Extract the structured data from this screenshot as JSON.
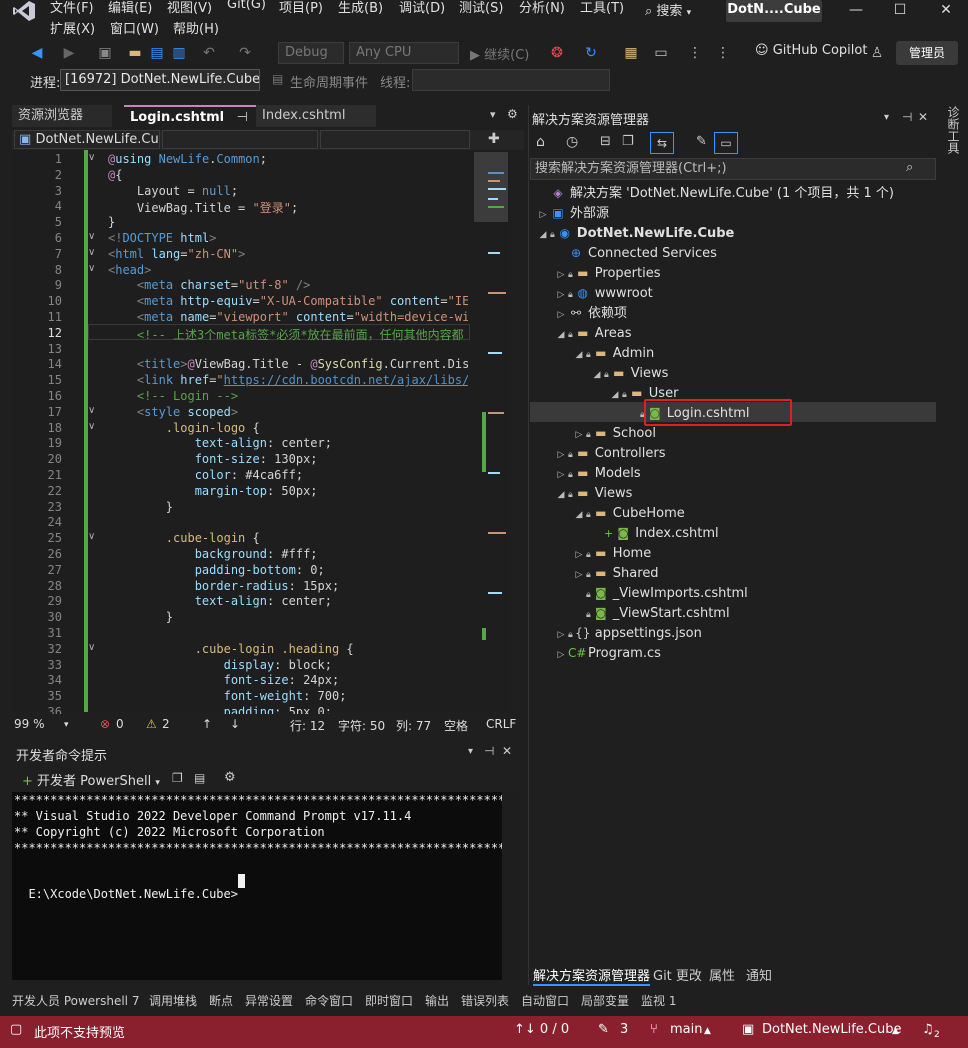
{
  "menu": {
    "items": [
      "文件(F)",
      "编辑(E)",
      "视图(V)",
      "Git(G)",
      "项目(P)",
      "生成(B)",
      "调试(D)",
      "测试(S)",
      "分析(N)",
      "工具(T)",
      "扩展(X)",
      "窗口(W)",
      "帮助(H)"
    ],
    "search": "搜索",
    "title_badge": "DotN....Cube"
  },
  "toolbar": {
    "config": "Debug",
    "platform": "Any CPU",
    "continue": "继续(C)",
    "copilot": "GitHub Copilot",
    "admin": "管理员"
  },
  "process_bar": {
    "process_label": "进程:",
    "process_value": "[16972] DotNet.NewLife.Cube.e",
    "lifecycle_label": "生命周期事件",
    "thread_label": "线程:"
  },
  "editor": {
    "tabs": [
      "资源浏览器",
      "Login.cshtml",
      "Index.cshtml"
    ],
    "nav_scope": "DotNet.NewLife.Cub",
    "zoom": "99 %",
    "errors": "0",
    "warnings": "2",
    "line": "行: 12",
    "char": "字符: 50",
    "col": "列: 77",
    "spacing": "空格",
    "eol": "CRLF",
    "current_line": 12
  },
  "devcmd": {
    "title": "开发者命令提示",
    "shell_button": "开发者 PowerShell",
    "lines": [
      "**********************************************************************",
      "** Visual Studio 2022 Developer Command Prompt v17.11.4",
      "** Copyright (c) 2022 Microsoft Corporation",
      "**********************************************************************",
      "",
      "E:\\Xcode\\DotNet.NewLife.Cube>"
    ]
  },
  "solution_explorer": {
    "title": "解决方案资源管理器",
    "search_placeholder": "搜索解决方案资源管理器(Ctrl+;)",
    "tree": [
      {
        "label": "解决方案 'DotNet.NewLife.Cube' (1 个项目，共 1 个)",
        "icon": "solution-icon",
        "arrow": "",
        "depth": 0,
        "lock": false
      },
      {
        "label": "外部源",
        "icon": "external-icon",
        "arrow": "▷",
        "depth": 0,
        "lock": false
      },
      {
        "label": "DotNet.NewLife.Cube",
        "icon": "project-icon",
        "arrow": "◢",
        "depth": 0,
        "lock": true,
        "bold": true
      },
      {
        "label": "Connected Services",
        "icon": "connected-services-icon",
        "arrow": "",
        "depth": 1,
        "lock": false
      },
      {
        "label": "Properties",
        "icon": "folder-icon",
        "arrow": "▷",
        "depth": 1,
        "lock": true
      },
      {
        "label": "wwwroot",
        "icon": "globe-icon",
        "arrow": "▷",
        "depth": 1,
        "lock": true
      },
      {
        "label": "依赖项",
        "icon": "dependencies-icon",
        "arrow": "▷",
        "depth": 1,
        "lock": false
      },
      {
        "label": "Areas",
        "icon": "folder-icon",
        "arrow": "◢",
        "depth": 1,
        "lock": true
      },
      {
        "label": "Admin",
        "icon": "folder-icon",
        "arrow": "◢",
        "depth": 2,
        "lock": true
      },
      {
        "label": "Views",
        "icon": "folder-icon",
        "arrow": "◢",
        "depth": 3,
        "lock": true
      },
      {
        "label": "User",
        "icon": "folder-icon",
        "arrow": "◢",
        "depth": 4,
        "lock": true
      },
      {
        "label": "Login.cshtml",
        "icon": "razor-file-icon",
        "arrow": "",
        "depth": 5,
        "lock": true,
        "selected": true
      },
      {
        "label": "School",
        "icon": "folder-icon",
        "arrow": "▷",
        "depth": 2,
        "lock": true
      },
      {
        "label": "Controllers",
        "icon": "folder-icon",
        "arrow": "▷",
        "depth": 1,
        "lock": true
      },
      {
        "label": "Models",
        "icon": "folder-icon",
        "arrow": "▷",
        "depth": 1,
        "lock": true
      },
      {
        "label": "Views",
        "icon": "folder-icon",
        "arrow": "◢",
        "depth": 1,
        "lock": true
      },
      {
        "label": "CubeHome",
        "icon": "folder-icon",
        "arrow": "◢",
        "depth": 2,
        "lock": true
      },
      {
        "label": "Index.cshtml",
        "icon": "razor-file-icon",
        "arrow": "",
        "depth": 3,
        "lock": false,
        "plus": true
      },
      {
        "label": "Home",
        "icon": "folder-icon",
        "arrow": "▷",
        "depth": 2,
        "lock": true
      },
      {
        "label": "Shared",
        "icon": "folder-icon",
        "arrow": "▷",
        "depth": 2,
        "lock": true
      },
      {
        "label": "_ViewImports.cshtml",
        "icon": "razor-file-icon",
        "arrow": "",
        "depth": 2,
        "lock": true
      },
      {
        "label": "_ViewStart.cshtml",
        "icon": "razor-file-icon",
        "arrow": "",
        "depth": 2,
        "lock": true
      },
      {
        "label": "appsettings.json",
        "icon": "json-icon",
        "arrow": "▷",
        "depth": 1,
        "lock": true
      },
      {
        "label": "Program.cs",
        "icon": "csharp-icon",
        "arrow": "▷",
        "depth": 1,
        "lock": false
      }
    ],
    "bottom_tabs": [
      "解决方案资源管理器",
      "Git 更改",
      "属性",
      "通知"
    ]
  },
  "diag_rail": "诊断工具",
  "tool_tabs": [
    "开发人员 Powershell 7",
    "调用堆栈",
    "断点",
    "异常设置",
    "命令窗口",
    "即时窗口",
    "输出",
    "错误列表",
    "自动窗口",
    "局部变量",
    "监视 1"
  ],
  "statusbar": {
    "message": "此项不支持预览",
    "sync": "↑↓ 0 / 0",
    "edits": "3",
    "branch": "main",
    "repo": "DotNet.NewLife.Cube",
    "notifications": "2"
  },
  "colors": {
    "statusbar": "#8a1f2e",
    "selection_box": "#e02020",
    "accent_tab": "#c586c0"
  }
}
